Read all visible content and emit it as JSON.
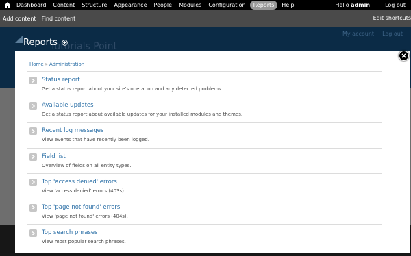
{
  "toolbar": {
    "menu": [
      "Dashboard",
      "Content",
      "Structure",
      "Appearance",
      "People",
      "Modules",
      "Configuration",
      "Reports",
      "Help"
    ],
    "active": "Reports",
    "hello_prefix": "Hello",
    "username": "admin",
    "logout": "Log out"
  },
  "shortcuts": {
    "items": [
      "Add content",
      "Find content"
    ],
    "edit": "Edit shortcuts"
  },
  "background": {
    "site_name": "Tutorials Point",
    "links": [
      "My account",
      "Log out"
    ]
  },
  "overlay": {
    "title": "Reports",
    "breadcrumb": [
      "Home",
      "Administration"
    ],
    "breadcrumb_sep": "»"
  },
  "entries": [
    {
      "title": "Status report",
      "desc": "Get a status report about your site's operation and any detected problems."
    },
    {
      "title": "Available updates",
      "desc": "Get a status report about available updates for your installed modules and themes."
    },
    {
      "title": "Recent log messages",
      "desc": "View events that have recently been logged."
    },
    {
      "title": "Field list",
      "desc": "Overview of fields on all entity types."
    },
    {
      "title": "Top 'access denied' errors",
      "desc": "View 'access denied' errors (403s)."
    },
    {
      "title": "Top 'page not found' errors",
      "desc": "View 'page not found' errors (404s)."
    },
    {
      "title": "Top search phrases",
      "desc": "View most popular search phrases."
    }
  ],
  "icons": {
    "home": "home-icon",
    "add_shortcut": "plus-circle-icon",
    "close": "close-icon",
    "entry_arrow": "chevron-right-icon"
  },
  "colors": {
    "toolbar": "#000000",
    "shortcut_bar": "#4a4a4a",
    "active_tab": "#979797",
    "link": "#2b6fa6",
    "header_bg": "#0b2b46"
  }
}
